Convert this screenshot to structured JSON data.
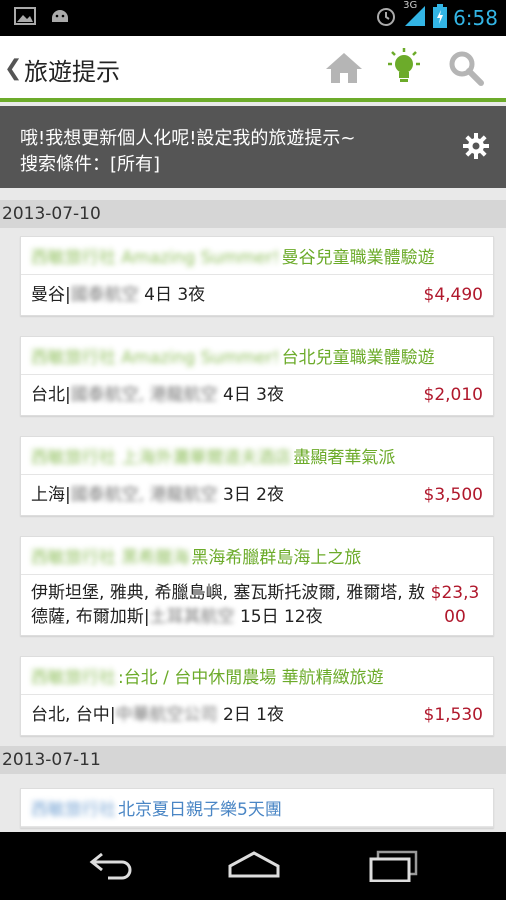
{
  "status_bar": {
    "time": "6:58",
    "network": "3G",
    "icons": [
      "image-icon",
      "android-icon",
      "alarm-icon",
      "signal-icon",
      "battery-icon"
    ]
  },
  "action_bar": {
    "title": "旅遊提示",
    "icons": [
      "home-icon",
      "lightbulb-icon",
      "search-icon"
    ],
    "accent": "#6cab2a"
  },
  "banner": {
    "line1": "哦!我想更新個人化呢!設定我的旅遊提示~",
    "line2": "搜索條件：[所有]"
  },
  "sections": [
    {
      "date": "2013-07-10",
      "items": [
        {
          "title_blur": "西敏旅行社 Amazing Summer!",
          "title": "曼谷兒童職業體驗遊",
          "dest": "曼谷",
          "airline_blur": "國泰航空",
          "duration": "4日 3夜",
          "price": "$4,490"
        },
        {
          "title_blur": "西敏旅行社 Amazing Summer!",
          "title": "台北兒童職業體驗遊",
          "dest": "台北",
          "airline_blur": "國泰航空, 港龍航空",
          "duration": "4日 3夜",
          "price": "$2,010"
        },
        {
          "title_blur": "西敏旅行社 上海外灘華爾道夫酒店",
          "title": "盡顯奢華氣派",
          "dest": "上海",
          "airline_blur": "國泰航空, 港龍航空",
          "duration": "3日 2夜",
          "price": "$3,500"
        },
        {
          "title_blur": "西敏旅行社 黑希臘海 ",
          "title": "黑海希臘群島海上之旅",
          "dest": "伊斯坦堡, 雅典, 希臘島嶼, 塞瓦斯托波爾, 雅爾塔, 敖德薩, 布爾加斯",
          "airline_blur": "土耳其航空",
          "duration": "15日 12夜",
          "price": "$23,300"
        },
        {
          "title_blur": "西敏旅行社",
          "title": ":台北 / 台中休閒農場 華航精緻旅遊",
          "dest": "台北, 台中",
          "airline_blur": "中華航空公司",
          "duration": "2日 1夜",
          "price": "$1,530"
        }
      ]
    },
    {
      "date": "2013-07-11",
      "items": [
        {
          "title_blur": "西敏旅行社",
          "title": "北京夏日親子樂5天團",
          "dest": "",
          "airline_blur": "",
          "duration": "",
          "price": ""
        }
      ]
    }
  ],
  "navbar": {
    "icons": [
      "back-icon",
      "home-nav-icon",
      "recent-apps-icon"
    ]
  }
}
